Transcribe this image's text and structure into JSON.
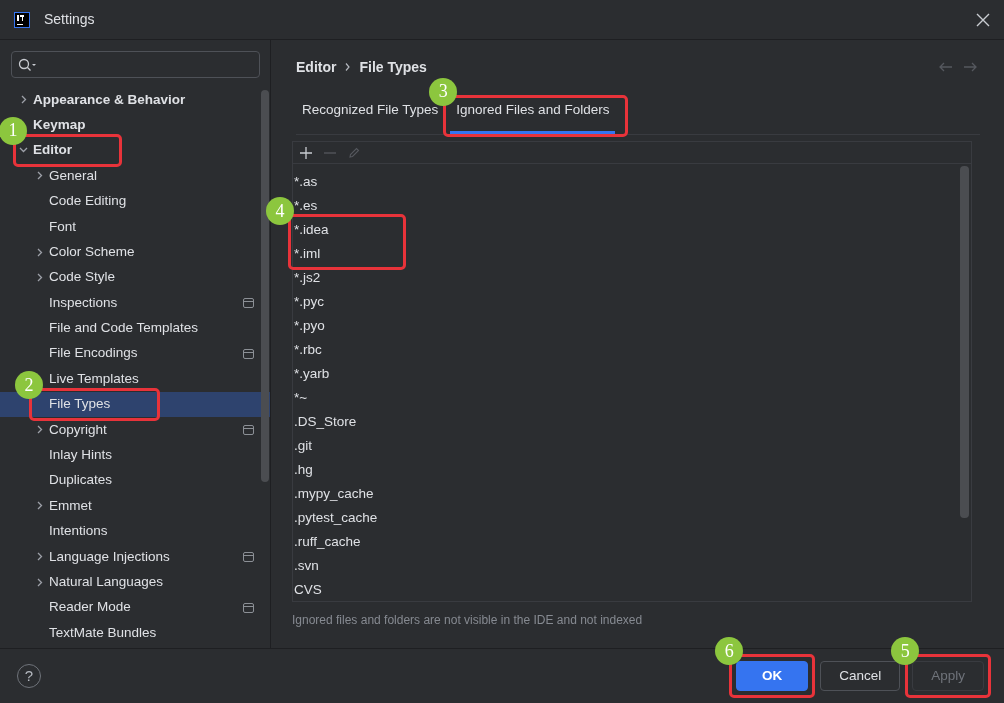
{
  "window": {
    "title": "Settings"
  },
  "sidebar": {
    "items": [
      {
        "label": "Appearance & Behavior",
        "bold": true,
        "expanded": false,
        "selected": false
      },
      {
        "label": "Keymap",
        "bold": true,
        "selected": false
      },
      {
        "label": "Editor",
        "bold": true,
        "expanded": true,
        "selected": false,
        "outlined": true,
        "callout": "1",
        "children": [
          {
            "label": "General",
            "expanded": false,
            "selected": false
          },
          {
            "label": "Code Editing",
            "selected": false
          },
          {
            "label": "Font",
            "selected": false
          },
          {
            "label": "Color Scheme",
            "expanded": false,
            "selected": false
          },
          {
            "label": "Code Style",
            "expanded": false,
            "selected": false
          },
          {
            "label": "Inspections",
            "project_level": true,
            "selected": false
          },
          {
            "label": "File and Code Templates",
            "selected": false
          },
          {
            "label": "File Encodings",
            "project_level": true,
            "selected": false
          },
          {
            "label": "Live Templates",
            "selected": false
          },
          {
            "label": "File Types",
            "selected": true,
            "outlined": true,
            "callout": "2"
          },
          {
            "label": "Copyright",
            "expanded": false,
            "project_level": true,
            "selected": false
          },
          {
            "label": "Inlay Hints",
            "selected": false
          },
          {
            "label": "Duplicates",
            "selected": false
          },
          {
            "label": "Emmet",
            "expanded": false,
            "selected": false
          },
          {
            "label": "Intentions",
            "selected": false
          },
          {
            "label": "Language Injections",
            "expanded": false,
            "project_level": true,
            "selected": false
          },
          {
            "label": "Natural Languages",
            "expanded": false,
            "selected": false
          },
          {
            "label": "Reader Mode",
            "project_level": true,
            "selected": false
          },
          {
            "label": "TextMate Bundles",
            "selected": false
          }
        ]
      }
    ]
  },
  "breadcrumb": [
    "Editor",
    "File Types"
  ],
  "history": [
    {
      "kind": "back",
      "disabled": true
    },
    {
      "kind": "forward",
      "disabled": true
    }
  ],
  "tabs": [
    {
      "label": "Recognized File Types",
      "selected": false
    },
    {
      "label": "Ignored Files and Folders",
      "selected": true,
      "outlined": true,
      "callout": "3"
    }
  ],
  "toolbar": [
    {
      "kind": "add",
      "disabled": false
    },
    {
      "kind": "remove",
      "disabled": true
    },
    {
      "kind": "edit",
      "disabled": true
    }
  ],
  "files": [
    {
      "pattern": "*.as"
    },
    {
      "pattern": "*.es"
    },
    {
      "pattern": "*.idea",
      "outlined": true,
      "callout": "4"
    },
    {
      "pattern": "*.iml",
      "outlined": true
    },
    {
      "pattern": "*.js2"
    },
    {
      "pattern": "*.pyc"
    },
    {
      "pattern": "*.pyo"
    },
    {
      "pattern": "*.rbc"
    },
    {
      "pattern": "*.yarb"
    },
    {
      "pattern": "*~"
    },
    {
      "pattern": ".DS_Store"
    },
    {
      "pattern": ".git"
    },
    {
      "pattern": ".hg"
    },
    {
      "pattern": ".mypy_cache"
    },
    {
      "pattern": ".pytest_cache"
    },
    {
      "pattern": ".ruff_cache"
    },
    {
      "pattern": ".svn"
    },
    {
      "pattern": "CVS"
    }
  ],
  "hint": "Ignored files and folders are not visible in the IDE and not indexed",
  "help": {
    "label": "?"
  },
  "buttons": [
    {
      "label": "OK",
      "kind": "primary",
      "disabled": false,
      "outlined": true,
      "callout": "6"
    },
    {
      "label": "Cancel",
      "kind": "secondary",
      "disabled": false
    },
    {
      "label": "Apply",
      "kind": "secondary",
      "disabled": true,
      "outlined": true,
      "callout": "5"
    }
  ]
}
